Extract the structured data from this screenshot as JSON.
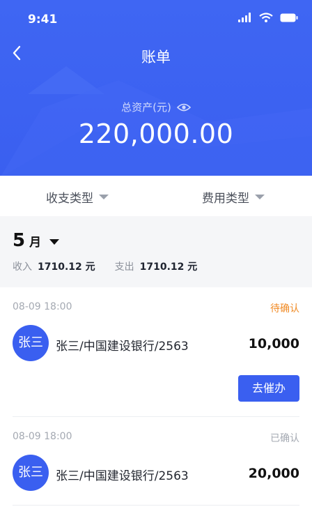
{
  "status_bar": {
    "time": "9:41"
  },
  "nav": {
    "title": "账单"
  },
  "assets": {
    "label": "总资产(元)",
    "value": "220,000.00"
  },
  "filters": [
    {
      "label": "收支类型"
    },
    {
      "label": "费用类型"
    }
  ],
  "month": {
    "number": "5",
    "unit": "月",
    "income_label": "收入",
    "income_value": "1710.12 元",
    "expense_label": "支出",
    "expense_value": "1710.12 元"
  },
  "records": [
    {
      "date": "08-09 18:00",
      "status": "待确认",
      "status_color": "#f08a24",
      "avatar": "张三",
      "name": "张三/中国建设银行/2563",
      "amount": "10,000",
      "action": "去催办"
    },
    {
      "date": "08-09 18:00",
      "status": "已确认",
      "status_color": "#a4a9b2",
      "avatar": "张三",
      "name": "张三/中国建设银行/2563",
      "amount": "20,000"
    }
  ],
  "colors": {
    "primary": "#3a5ff0",
    "pending": "#f08a24"
  }
}
